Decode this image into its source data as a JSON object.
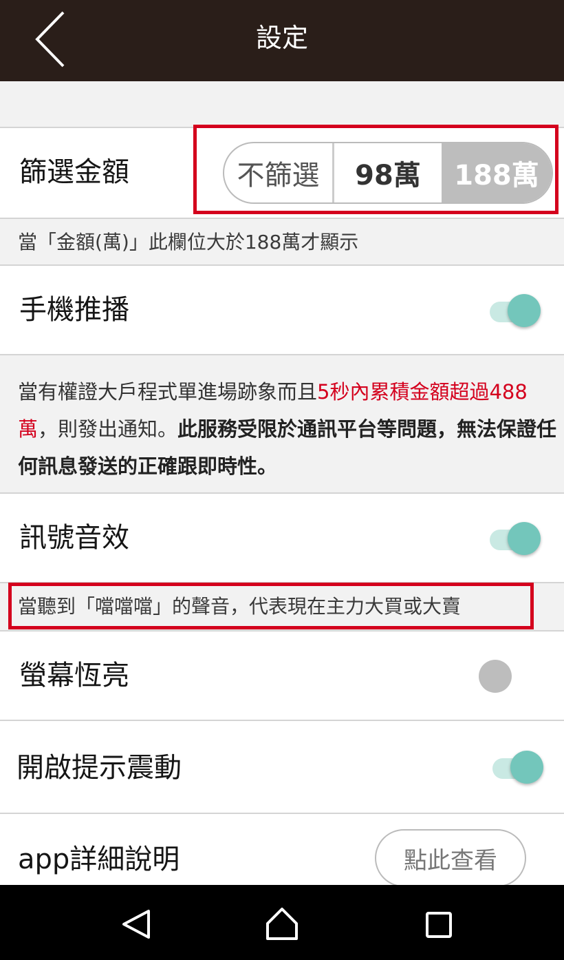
{
  "header": {
    "title": "設定"
  },
  "filter_amount": {
    "label": "篩選金額",
    "options": [
      "不篩選",
      "98萬",
      "188萬"
    ],
    "selected_index": 2,
    "note": "當「金額(萬)」此欄位大於188萬才顯示",
    "highlight_color": "#d4001d"
  },
  "push": {
    "label": "手機推播",
    "enabled": true,
    "desc_part1": "當有權證大戶程式單進場跡象而且",
    "desc_red": "5秒內累積金額超過488萬",
    "desc_part2": "，則發出通知。",
    "desc_bold": "此服務受限於通訊平台等問題，無法保證任何訊息發送的正確跟即時性。"
  },
  "sound": {
    "label": "訊號音效",
    "enabled": true,
    "note": "當聽到「噹噹噹」的聲音，代表現在主力大買或大賣"
  },
  "screen_on": {
    "label": "螢幕恆亮",
    "enabled": false
  },
  "vibrate": {
    "label": "開啟提示震動",
    "enabled": true
  },
  "app_help": {
    "label": "app詳細說明",
    "button": "點此查看"
  },
  "colors": {
    "topbar": "#2a1e19",
    "toggle_on": "#73c6bb",
    "toggle_off": "#bdbdbd",
    "accent_red": "#d4001d"
  },
  "icons": {
    "back": "chevron-left-icon",
    "nav": [
      "back-triangle-icon",
      "home-icon",
      "recents-square-icon"
    ]
  }
}
